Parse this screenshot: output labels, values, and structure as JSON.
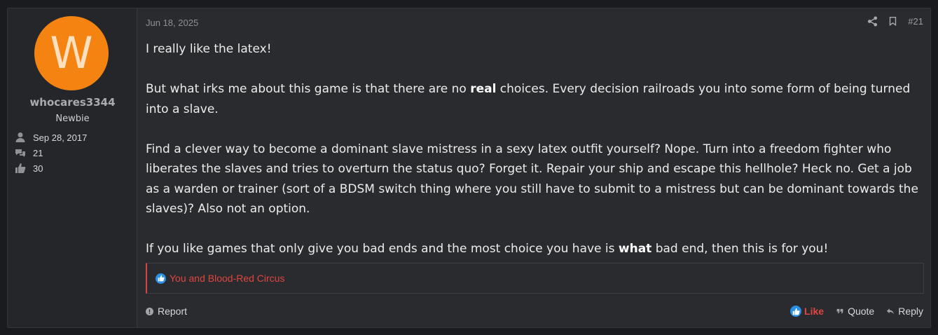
{
  "user": {
    "avatar_letter": "W",
    "avatar_color": "#f48312",
    "name": "whocares3344",
    "title": "Newbie",
    "joined": "Sep 28, 2017",
    "messages": "21",
    "reactions": "30"
  },
  "post": {
    "date": "Jun 18, 2025",
    "number": "#21",
    "paragraphs": {
      "p1": "I really like the latex!",
      "p2_a": "But what irks me about this game is that there are no ",
      "p2_b": "real",
      "p2_c": " choices. Every decision railroads you into some form of being turned into a slave.",
      "p3": "Find a clever way to become a dominant slave mistress in a sexy latex outfit yourself? Nope. Turn into a freedom fighter who liberates the slaves and tries to overturn the status quo? Forget it. Repair your ship and escape this hellhole? Heck no. Get a job as a warden or trainer (sort of a BDSM switch thing where you still have to submit to a mistress but can be dominant towards the slaves)? Also not an option.",
      "p4_a": "If you like games that only give you bad ends and the most choice you have is ",
      "p4_b": "what",
      "p4_c": " bad end, then this is for you!"
    },
    "reactions_text": "You and Blood-Red Circus"
  },
  "footer": {
    "report": "Report",
    "like": "Like",
    "quote": "Quote",
    "reply": "Reply"
  },
  "colors": {
    "accent_red": "#e0463f",
    "like_blue": "#2b8fe6"
  },
  "icons": [
    "user-icon",
    "comments-icon",
    "thumbs-up-icon",
    "share-icon",
    "bookmark-icon",
    "alert-icon",
    "quote-icon",
    "reply-icon"
  ]
}
